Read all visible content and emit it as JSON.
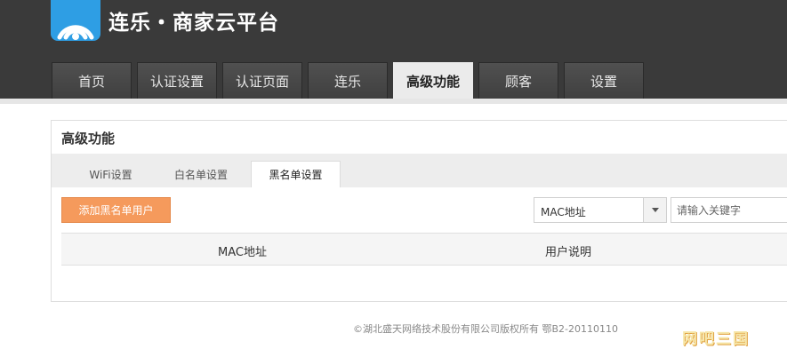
{
  "app": {
    "title": "连乐・商家云平台"
  },
  "nav": {
    "tabs": [
      {
        "label": "首页"
      },
      {
        "label": "认证设置"
      },
      {
        "label": "认证页面"
      },
      {
        "label": "连乐"
      },
      {
        "label": "高级功能",
        "active": true
      },
      {
        "label": "顾客"
      },
      {
        "label": "设置"
      }
    ]
  },
  "panel": {
    "title": "高级功能",
    "subtabs": [
      {
        "label": "WiFi设置"
      },
      {
        "label": "白名单设置"
      },
      {
        "label": "黑名单设置",
        "active": true
      }
    ],
    "add_button": "添加黑名单用户",
    "filter": {
      "selected": "MAC地址"
    },
    "search": {
      "placeholder": "请输入关键字"
    },
    "table": {
      "columns": [
        "MAC地址",
        "用户说明"
      ]
    }
  },
  "footer": {
    "copyright": "©湖北盛天网络技术股份有限公司版权所有 鄂B2-20110110"
  },
  "watermark": {
    "text": "网吧三国"
  },
  "colors": {
    "header_bg": "#3a3a3a",
    "accent": "#f59a5c",
    "logo": "#2e9ee4"
  },
  "icons": {
    "logo": "wifi-signal-icon",
    "dropdown": "caret-down-icon"
  }
}
